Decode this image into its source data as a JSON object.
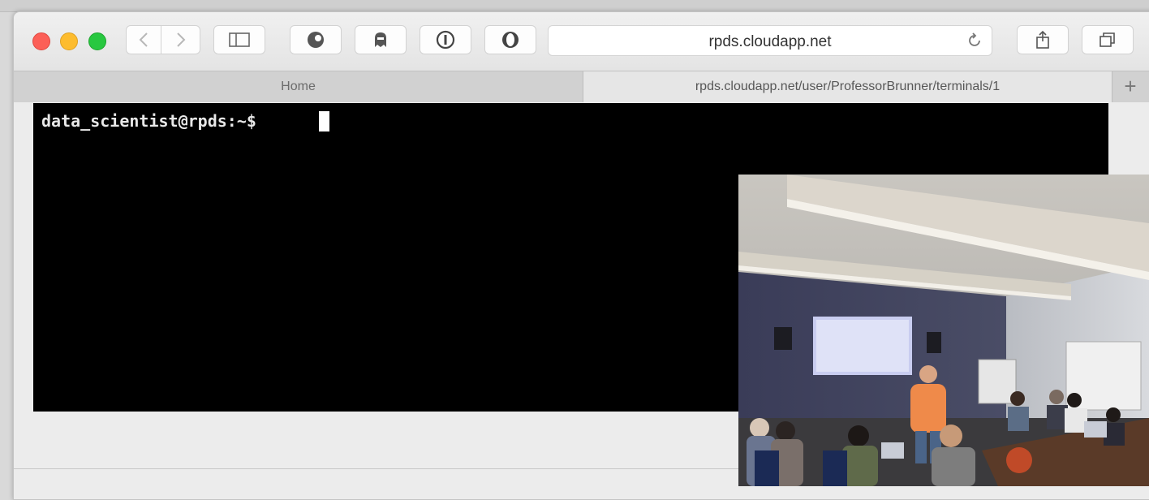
{
  "browser": {
    "address_url": "rpds.cloudapp.net",
    "tabs": [
      {
        "label": "Home"
      },
      {
        "label": "rpds.cloudapp.net/user/ProfessorBrunner/terminals/1"
      }
    ],
    "new_tab_label": "+"
  },
  "terminal": {
    "prompt": "data_scientist@rpds:~$"
  },
  "icons": {
    "back": "chevron-left-icon",
    "forward": "chevron-right-icon",
    "sidebar": "sidebar-icon",
    "ext1": "ghostery-icon",
    "ext2": "ghost-icon",
    "ext3": "onepassword-icon",
    "ext4": "privacy-icon",
    "reload": "reload-icon",
    "share": "share-icon",
    "tabs": "tabs-overview-icon"
  },
  "colors": {
    "close": "#fc5f57",
    "minimize": "#fdbc2e",
    "zoom": "#28c840",
    "terminal_bg": "#000000",
    "terminal_fg": "#e8e8e8"
  }
}
